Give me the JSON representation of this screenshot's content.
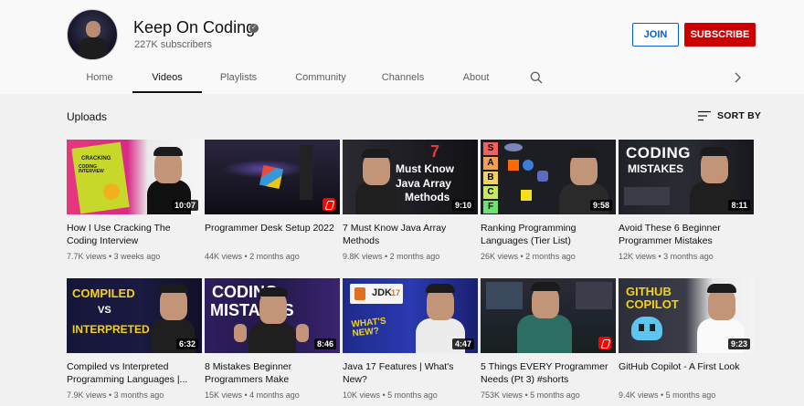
{
  "channel": {
    "name": "Keep On Coding",
    "subscribers": "227K subscribers",
    "join_label": "JOIN",
    "subscribe_label": "SUBSCRIBE",
    "subscribe_color": "#cc0000"
  },
  "tabs": [
    {
      "label": "Home",
      "active": false
    },
    {
      "label": "Videos",
      "active": true
    },
    {
      "label": "Playlists",
      "active": false
    },
    {
      "label": "Community",
      "active": false
    },
    {
      "label": "Channels",
      "active": false
    },
    {
      "label": "About",
      "active": false
    }
  ],
  "icons": {
    "search": "search-icon",
    "next": "chevron-right-icon",
    "sort": "sort-icon",
    "verified": "verified-check-icon"
  },
  "section": {
    "title": "Uploads",
    "sort_label": "SORT BY"
  },
  "videos": [
    {
      "title": "How I Use Cracking The Coding Interview",
      "meta": "7.7K views • 3 weeks ago",
      "duration": "10:07",
      "thumb_text": [
        "CRACKING",
        "CODING INTERVIEW"
      ]
    },
    {
      "title": "Programmer Desk Setup 2022",
      "meta": "44K views • 2 months ago",
      "duration": "",
      "short": true
    },
    {
      "title": "7 Must Know Java Array Methods",
      "meta": "9.8K views • 2 months ago",
      "duration": "9:10",
      "thumb_text": [
        "7",
        "Must Know",
        "Java Array",
        "Methods"
      ]
    },
    {
      "title": "Ranking Programming Languages (Tier List)",
      "meta": "26K views • 2 months ago",
      "duration": "9:58",
      "thumb_text": [
        "S",
        "A",
        "B",
        "C",
        "F"
      ]
    },
    {
      "title": "Avoid These 6 Beginner Programmer Mistakes",
      "meta": "12K views • 3 months ago",
      "duration": "8:11",
      "thumb_text": [
        "CODING",
        "MISTAKES"
      ]
    },
    {
      "title": "Compiled vs Interpreted Programming Languages |...",
      "meta": "7.9K views • 3 months ago",
      "duration": "6:32",
      "thumb_text": [
        "COMPILED",
        "VS",
        "INTERPRETED"
      ]
    },
    {
      "title": "8 Mistakes Beginner Programmers Make",
      "meta": "15K views • 4 months ago",
      "duration": "8:46",
      "thumb_text": [
        "CODING",
        "MISTAKES"
      ]
    },
    {
      "title": "Java 17 Features | What's New?",
      "meta": "10K views • 5 months ago",
      "duration": "4:47",
      "thumb_text": [
        "JDK",
        "17",
        "WHAT'S NEW?"
      ]
    },
    {
      "title": "5 Things EVERY Programmer Needs (Pt 3) #shorts",
      "meta": "753K views • 5 months ago",
      "duration": "",
      "short": true
    },
    {
      "title": "GitHub Copilot - A First Look",
      "meta": "9.4K views • 5 months ago",
      "duration": "9:23",
      "thumb_text": [
        "GITHUB",
        "COPILOT"
      ]
    }
  ]
}
